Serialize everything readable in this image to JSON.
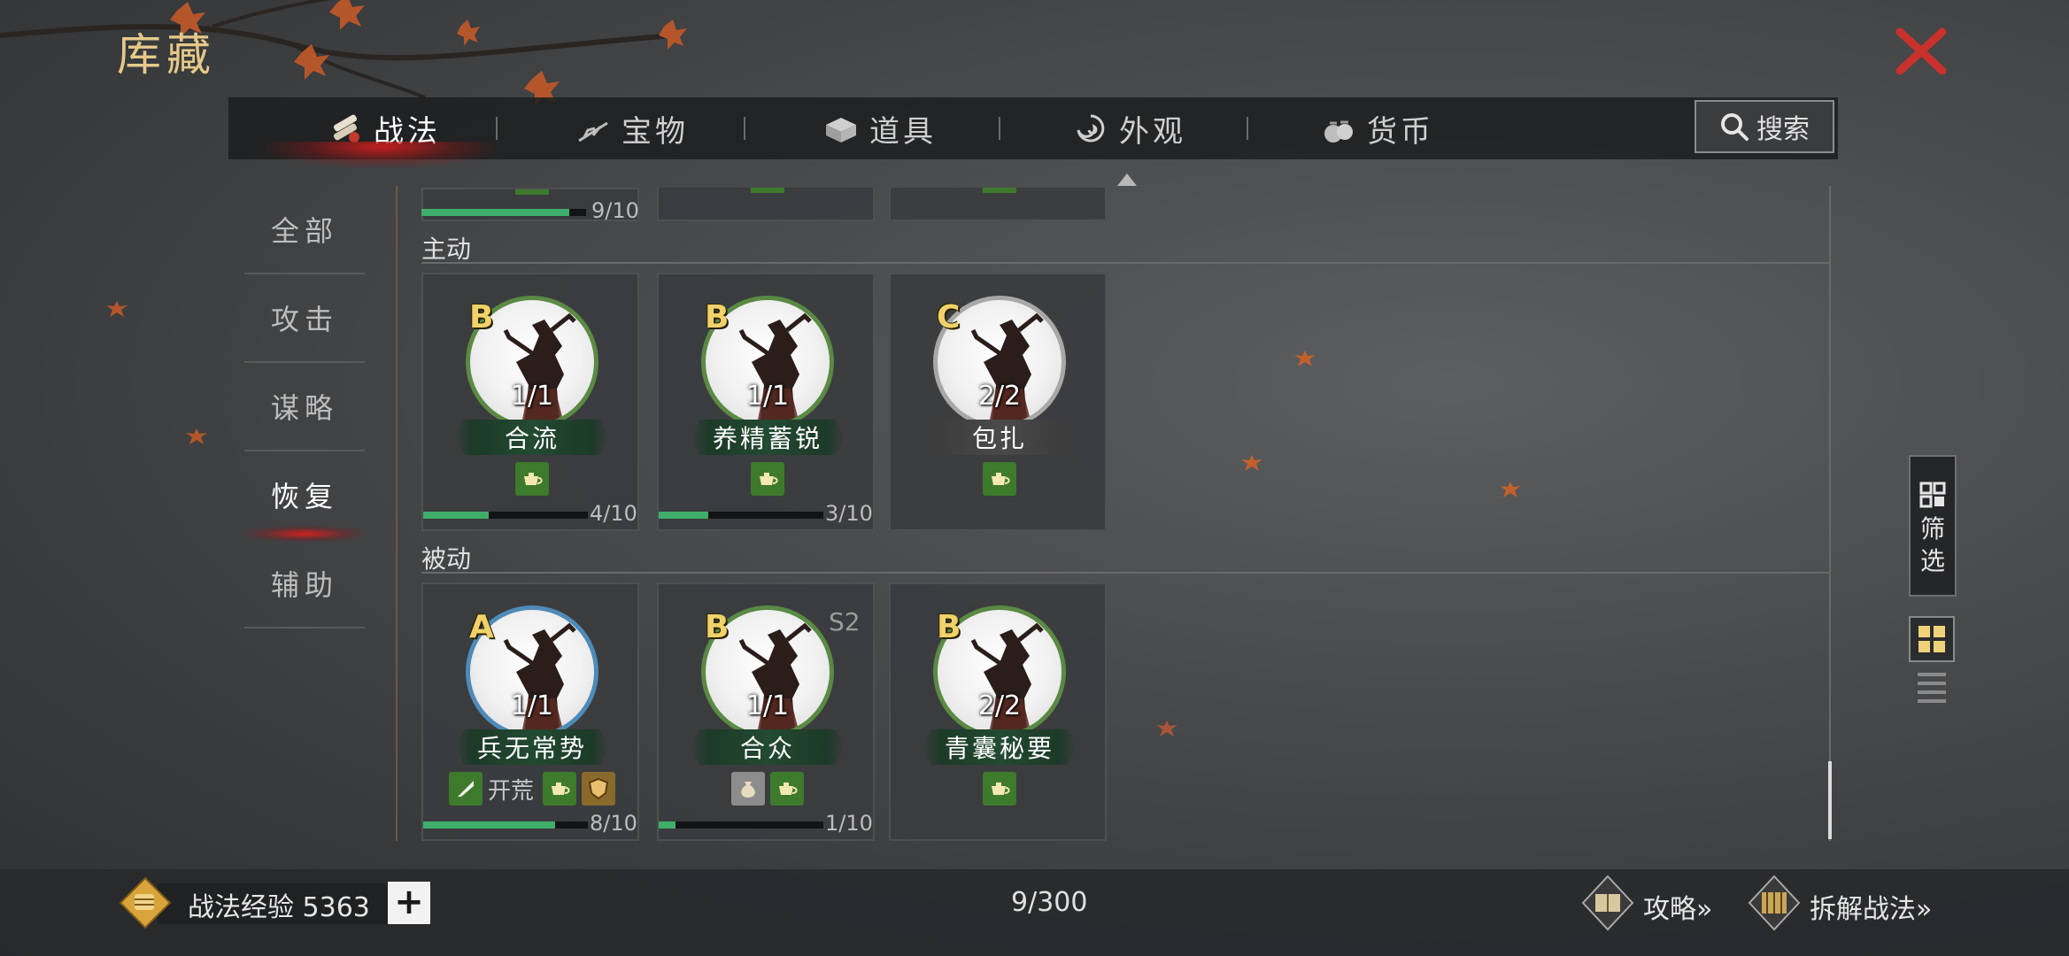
{
  "header": {
    "title": "库藏",
    "close_icon": "close-x-icon"
  },
  "tabs": [
    {
      "label": "战法",
      "icon": "scroll-icon",
      "active": true
    },
    {
      "label": "宝物",
      "icon": "treasure-icon",
      "active": false
    },
    {
      "label": "道具",
      "icon": "box-icon",
      "active": false
    },
    {
      "label": "外观",
      "icon": "swirl-icon",
      "active": false
    },
    {
      "label": "货币",
      "icon": "money-bag-icon",
      "active": false
    }
  ],
  "search": {
    "label": "搜索",
    "icon": "search-icon"
  },
  "categories": [
    {
      "label": "全部",
      "active": false
    },
    {
      "label": "攻击",
      "active": false
    },
    {
      "label": "谋略",
      "active": false
    },
    {
      "label": "恢复",
      "active": true
    },
    {
      "label": "辅助",
      "active": false
    }
  ],
  "partial_row": {
    "first_bar_label": "9/10",
    "first_bar_progress": 0.9
  },
  "sections": [
    {
      "label": "主动",
      "cards": [
        {
          "grade": "B",
          "count": "1/1",
          "name": "合流",
          "ring": "green",
          "plate": "green",
          "tags": [
            "tea-icon"
          ],
          "tag_text": "",
          "progress": 0.4,
          "progress_label": "4/10",
          "season": ""
        },
        {
          "grade": "B",
          "count": "1/1",
          "name": "养精蓄锐",
          "ring": "green",
          "plate": "green",
          "tags": [
            "tea-icon"
          ],
          "tag_text": "",
          "progress": 0.3,
          "progress_label": "3/10",
          "season": ""
        },
        {
          "grade": "C",
          "count": "2/2",
          "name": "包扎",
          "ring": "gray",
          "plate": "gray",
          "tags": [
            "tea-icon"
          ],
          "tag_text": "",
          "progress": null,
          "progress_label": "",
          "season": ""
        }
      ]
    },
    {
      "label": "被动",
      "cards": [
        {
          "grade": "A",
          "count": "1/1",
          "name": "兵无常势",
          "ring": "blue",
          "plate": "green",
          "tags": [
            "blade-icon",
            "tea-icon",
            "shield-icon"
          ],
          "tag_text": "开荒",
          "progress": 0.8,
          "progress_label": "8/10",
          "season": ""
        },
        {
          "grade": "B",
          "count": "1/1",
          "name": "合众",
          "ring": "green",
          "plate": "green",
          "tags": [
            "sack-icon",
            "tea-icon"
          ],
          "tag_text": "",
          "progress": 0.1,
          "progress_label": "1/10",
          "season": "S2"
        },
        {
          "grade": "B",
          "count": "2/2",
          "name": "青囊秘要",
          "ring": "green",
          "plate": "green",
          "tags": [
            "tea-icon"
          ],
          "tag_text": "",
          "progress": null,
          "progress_label": "",
          "season": ""
        }
      ]
    }
  ],
  "side": {
    "filter_label_1": "筛",
    "filter_label_2": "选",
    "filter_icon": "grid-filter-icon",
    "grid_view_icon": "grid-view-icon",
    "list_view_icon": "list-view-icon"
  },
  "footer": {
    "exp_label": "战法经验 5363",
    "plus": "+",
    "count": "9/300",
    "strategy_label": "攻略»",
    "dismantle_label": "拆解战法»"
  },
  "colors": {
    "title_gold": "#e6c98a",
    "close_red": "#c8312c",
    "progress_green": "#3fae6a",
    "grade_yellow": "#f1d26a",
    "active_glow": "#d21e1e"
  }
}
